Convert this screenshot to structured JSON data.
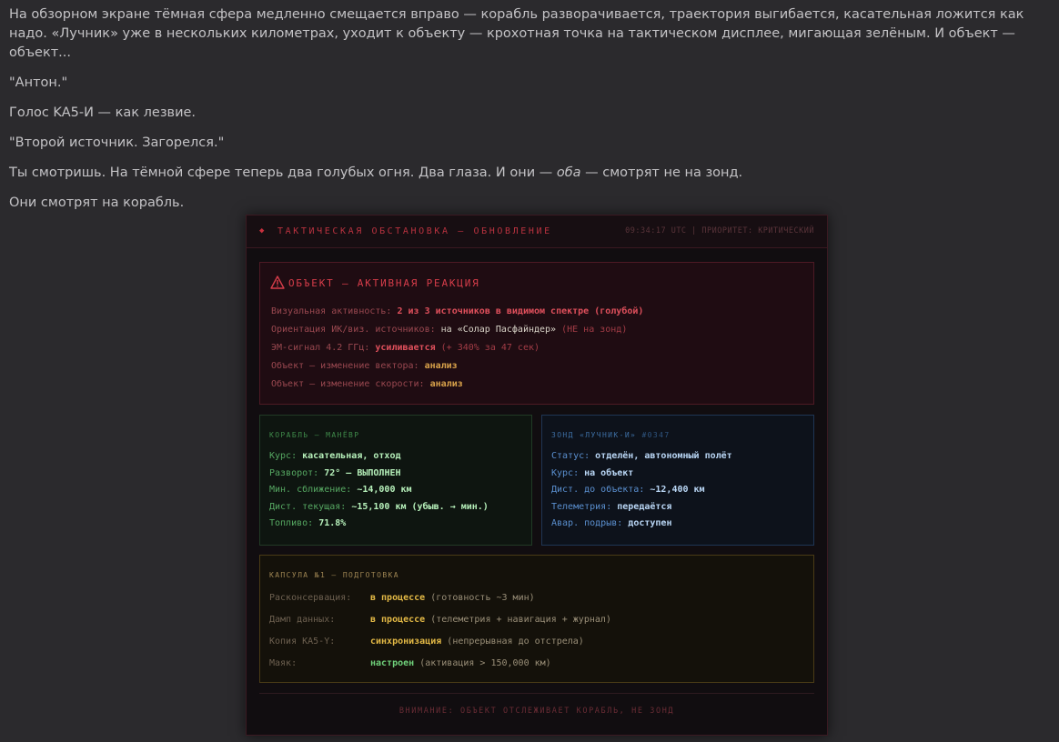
{
  "story": {
    "p1": "На обзорном экране тёмная сфера медленно смещается вправо — корабль разворачивается, траектория выгибается, касательная ложится как надо. «Лучник» уже в нескольких километрах, уходит к объекту — крохотная точка на тактическом дисплее, мигающая зелёным. И объект — объект...",
    "p2": "\"Антон.\"",
    "p3": "Голос KA5-И — как лезвие.",
    "p4": "\"Второй источник. Загорелся.\"",
    "p5_a": "Ты смотришь. На тёмной сфере теперь два голубых огня. Два глаза. И они — ",
    "p5_em": "оба",
    "p5_b": " — смотрят не на зонд.",
    "p6": "Они смотрят на корабль."
  },
  "panel": {
    "title": "ТАКТИЧЕСКАЯ ОБСТАНОВКА — ОБНОВЛЕНИЕ",
    "meta": "09:34:17 UTC | ПРИОРИТЕТ: КРИТИЧЕСКИЙ",
    "alert": {
      "heading": "ОБЪЕКТ — АКТИВНАЯ РЕАКЦИЯ",
      "rows": [
        {
          "label": "Визуальная активность: ",
          "value": "2 из 3 источников в видимом спектре (голубой)"
        },
        {
          "label": "Ориентация ИК/виз. источников: ",
          "value": "на «Солар Пасфайндер»",
          "extra": " (НЕ на зонд)"
        },
        {
          "label": "ЭМ-сигнал 4.2 ГГц: ",
          "value": "усиливается",
          "extra": " (+ 340% за 47 сек)"
        },
        {
          "label": "Объект — изменение вектора: ",
          "value": "анализ"
        },
        {
          "label": "Объект — изменение скорости: ",
          "value": "анализ"
        }
      ]
    },
    "ship": {
      "heading": "КОРАБЛЬ — МАНЁВР",
      "rows": [
        {
          "label": "Курс: ",
          "value": "касательная, отход"
        },
        {
          "label": "Разворот: ",
          "value": "72° — ВЫПОЛНЕН"
        },
        {
          "label": "Мин. сближение: ",
          "value": "~14,000 км"
        },
        {
          "label": "Дист. текущая: ",
          "value": "~15,100 км (убыв. → мин.)"
        },
        {
          "label": "Топливо: ",
          "value": "71.8%"
        }
      ]
    },
    "probe": {
      "heading": "ЗОНД «ЛУЧНИК-И»",
      "heading_num": "#0347",
      "rows": [
        {
          "label": "Статус: ",
          "value": "отделён, автономный полёт"
        },
        {
          "label": "Курс: ",
          "value": "на объект"
        },
        {
          "label": "Дист. до объекта: ",
          "value": "~12,400 км"
        },
        {
          "label": "Телеметрия: ",
          "value": "передаётся"
        },
        {
          "label": "Авар. подрыв: ",
          "value": "доступен"
        }
      ]
    },
    "capsule": {
      "heading": "КАПСУЛА №1 — ПОДГОТОВКА",
      "rows": [
        {
          "label": "Расконсервация:",
          "value": "в процессе",
          "note": " (готовность ~3 мин)"
        },
        {
          "label": "Дамп данных:",
          "value": "в процессе",
          "note": " (телеметрия + навигация + журнал)"
        },
        {
          "label": "Копия KA5-Y:",
          "value": "синхронизация",
          "note": " (непрерывная до отстрела)"
        },
        {
          "label": "Маяк:",
          "value": "настроен",
          "note": " (активация > 150,000 км)"
        }
      ]
    },
    "footer": "ВНИМАНИЕ: ОБЪЕКТ ОТСЛЕЖИВАЕТ КОРАБЛЬ, НЕ ЗОНД"
  },
  "colors": {
    "background": "#2b2a2d",
    "alert_red": "#d63d4a",
    "ship_green": "#56a862",
    "probe_blue": "#5a8fcf",
    "capsule_amber": "#e2b845"
  }
}
